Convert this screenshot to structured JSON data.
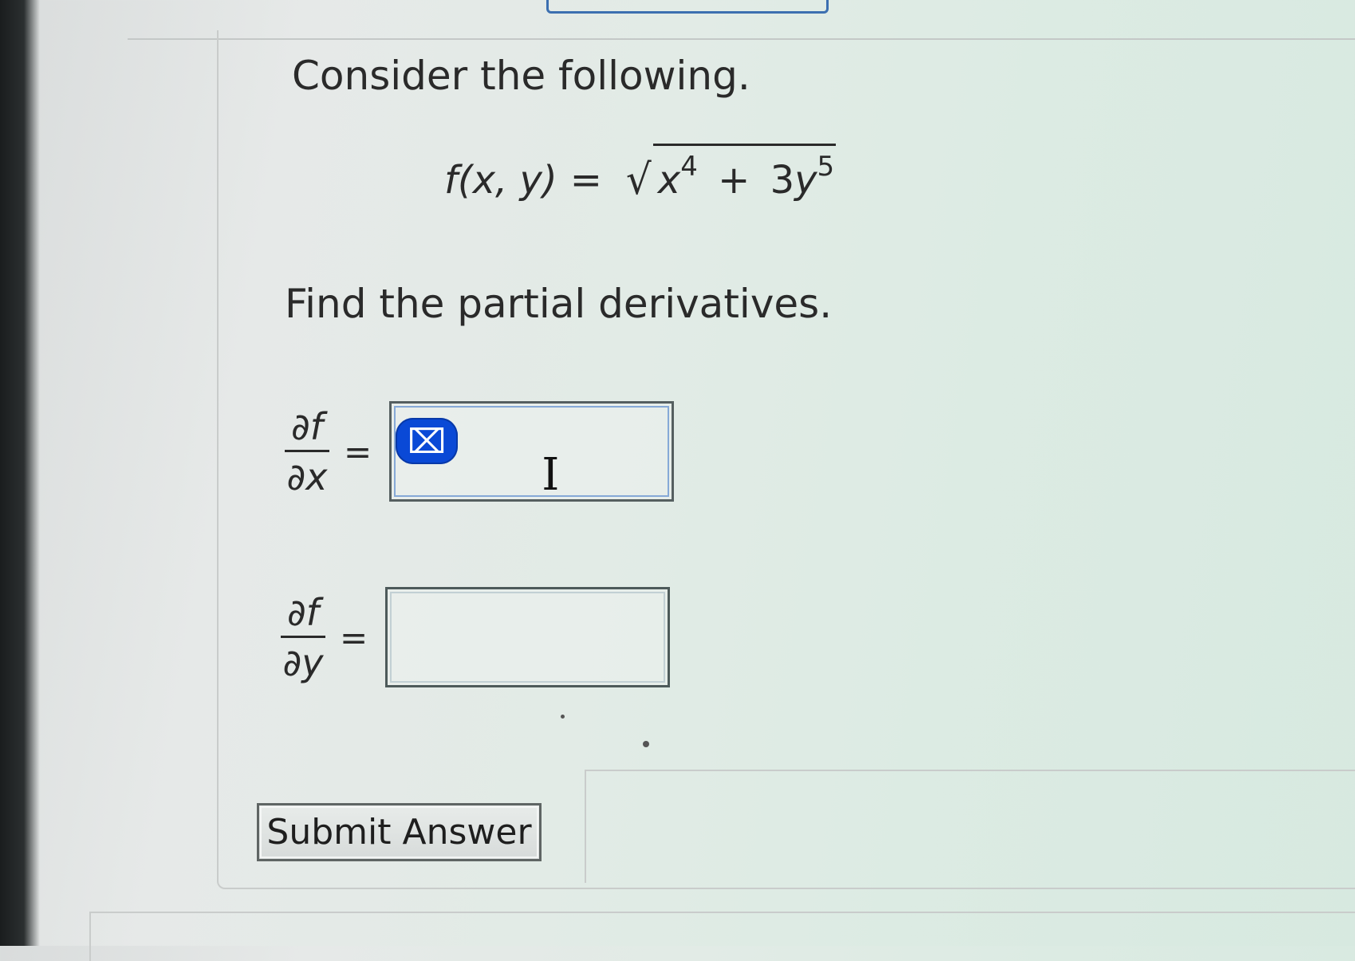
{
  "question": {
    "intro": "Consider the following.",
    "function": {
      "lhs": "f(x, y)",
      "equals": "=",
      "radical": "√",
      "term1_base": "x",
      "term1_exp": "4",
      "operator": "+",
      "term2_coef": "3",
      "term2_base": "y",
      "term2_exp": "5"
    },
    "instruction": "Find the partial derivatives."
  },
  "partials": [
    {
      "numerator_partial": "∂",
      "numerator_var": "f",
      "denominator_partial": "∂",
      "denominator_var": "x",
      "equals": "=",
      "answer_value": ""
    },
    {
      "numerator_partial": "∂",
      "numerator_var": "f",
      "denominator_partial": "∂",
      "denominator_var": "y",
      "equals": "=",
      "answer_value": ""
    }
  ],
  "clear_button": {
    "icon": "clear-format-icon",
    "glyph": "⌧"
  },
  "cursor": {
    "icon": "text-cursor-icon",
    "glyph": "I"
  },
  "submit": {
    "label": "Submit Answer"
  },
  "colors": {
    "accent_blue": "#0a49d6",
    "text": "#2a2a2a",
    "box_border": "#4d5a5a"
  }
}
